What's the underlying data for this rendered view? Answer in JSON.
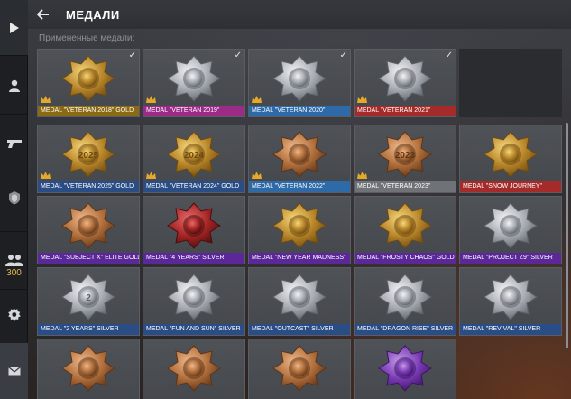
{
  "header": {
    "title": "МЕДАЛИ",
    "back_icon": "arrow-left-icon"
  },
  "applied_label": "Примененные медали:",
  "sidebar": {
    "friends_count": "300",
    "items": [
      {
        "name": "play",
        "icon": "play-icon"
      },
      {
        "name": "profile",
        "icon": "user-icon"
      },
      {
        "name": "weapon",
        "icon": "pistol-icon"
      },
      {
        "name": "clan",
        "icon": "clan-icon"
      },
      {
        "name": "friends",
        "icon": "friends-icon"
      },
      {
        "name": "settings",
        "icon": "gear-icon"
      },
      {
        "name": "mail",
        "icon": "envelope-icon"
      }
    ]
  },
  "colors": {
    "gold": "#8a6a14",
    "silver": "#2a4d86",
    "purple": "#5b2799",
    "pink": "#9b2b86",
    "red": "#a52a2a",
    "blue": "#2f6aa8",
    "gray": "#6f7277",
    "crown": "#e6a82a"
  },
  "applied": [
    {
      "label": "MEDAL \"VETERAN 2018\" GOLD",
      "color": "#8a6a14",
      "checked": true,
      "crown": true,
      "metal": "gold"
    },
    {
      "label": "MEDAL \"VETERAN 2019\"",
      "color": "#9b2b86",
      "checked": true,
      "crown": true,
      "metal": "silver"
    },
    {
      "label": "MEDAL \"VETERAN 2020\"",
      "color": "#2f6aa8",
      "checked": true,
      "crown": true,
      "metal": "silver"
    },
    {
      "label": "MEDAL \"VETERAN 2021\"",
      "color": "#a52a2a",
      "checked": true,
      "crown": true,
      "metal": "silver"
    }
  ],
  "medals": [
    {
      "label": "MEDAL \"VETERAN 2025\" GOLD",
      "color": "#2a4d86",
      "crown": true,
      "metal": "gold",
      "text": "2025"
    },
    {
      "label": "MEDAL \"VETERAN 2024\" GOLD",
      "color": "#2a4d86",
      "crown": true,
      "metal": "gold",
      "text": "2024"
    },
    {
      "label": "MEDAL \"VETERAN 2022\"",
      "color": "#2f6aa8",
      "crown": true,
      "metal": "bronze",
      "text": ""
    },
    {
      "label": "MEDAL \"VETERAN 2023\"",
      "color": "#6f7277",
      "crown": true,
      "metal": "bronze",
      "text": "2023"
    },
    {
      "label": "MEDAL \"SNOW JOURNEY\"",
      "color": "#a52a2a",
      "crown": false,
      "metal": "gold",
      "text": ""
    },
    {
      "label": "MEDAL \"SUBJECT X\" ELITE GOLD",
      "color": "#5b2799",
      "crown": false,
      "metal": "bronze",
      "text": ""
    },
    {
      "label": "MEDAL \"4 YEARS\" SILVER",
      "color": "#5b2799",
      "crown": false,
      "metal": "red",
      "text": ""
    },
    {
      "label": "MEDAL \"NEW YEAR MADNESS\"",
      "color": "#5b2799",
      "crown": false,
      "metal": "gold",
      "text": ""
    },
    {
      "label": "MEDAL \"FROSTY CHAOS\" GOLD",
      "color": "#5b2799",
      "crown": false,
      "metal": "gold",
      "text": ""
    },
    {
      "label": "MEDAL \"PROJECT Z9\" SILVER",
      "color": "#5b2799",
      "crown": false,
      "metal": "silver",
      "text": ""
    },
    {
      "label": "MEDAL \"2 YEARS\" SILVER",
      "color": "#2a4d86",
      "crown": false,
      "metal": "silver",
      "text": "2"
    },
    {
      "label": "MEDAL \"FUN AND SUN\" SILVER",
      "color": "#2a4d86",
      "crown": false,
      "metal": "silver",
      "text": ""
    },
    {
      "label": "MEDAL \"OUTCAST\" SILVER",
      "color": "#2a4d86",
      "crown": false,
      "metal": "silver",
      "text": ""
    },
    {
      "label": "MEDAL \"DRAGON RISE\" SILVER",
      "color": "#2a4d86",
      "crown": false,
      "metal": "silver",
      "text": ""
    },
    {
      "label": "MEDAL \"REVIVAL\" SILVER",
      "color": "#2a4d86",
      "crown": false,
      "metal": "silver",
      "text": ""
    },
    {
      "label": "",
      "color": "",
      "crown": false,
      "metal": "bronze",
      "text": ""
    },
    {
      "label": "",
      "color": "",
      "crown": false,
      "metal": "bronze",
      "text": ""
    },
    {
      "label": "",
      "color": "",
      "crown": false,
      "metal": "bronze",
      "text": ""
    },
    {
      "label": "",
      "color": "",
      "crown": false,
      "metal": "purple",
      "text": ""
    }
  ]
}
